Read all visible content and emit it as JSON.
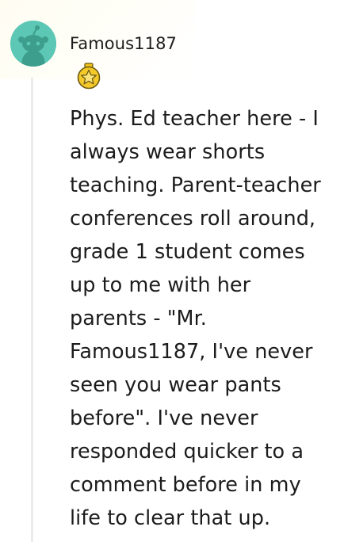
{
  "comment": {
    "username": "Famous1187",
    "avatar_icon": "snoo-avatar-icon",
    "avatar_color": "#5cc7b4",
    "flair_icon": "star-award-icon",
    "flair_color": "#f2c21b",
    "body": "Phys. Ed teacher here - I\nalways wear shorts\nteaching. Parent-teacher\nconferences roll around,\ngrade 1 student comes\nup to me with her\nparents - \"Mr.\nFamous1187, I've never\nseen you wear pants\nbefore\". I've never\nresponded quicker to a\ncomment before in my\nlife to clear that up."
  }
}
